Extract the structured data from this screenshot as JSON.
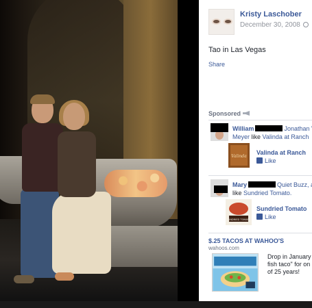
{
  "photo": {
    "alt": "Tao in Las Vegas photo"
  },
  "post": {
    "author": "Kristy Laschober",
    "date": "December 30, 2008",
    "caption": "Tao in Las Vegas",
    "share_label": "Share"
  },
  "sponsored": {
    "title": "Sponsored",
    "social_ads": [
      {
        "name": "William",
        "text_line1": "Jonathan V",
        "text_line2_link": "Meyer",
        "text_line2_mid": " like ",
        "text_line2_page": "Valinda at Ranch",
        "page_name": "Valinda at Ranch",
        "thumb_label": "Valinda",
        "like_label": "Like"
      },
      {
        "name": "Mary",
        "text_line1": "Quiet Buzz, a",
        "text_line2_mid": "like ",
        "text_line2_page": "Sundried Tomato.",
        "page_name": "Sundried Tomato",
        "thumb_label": "SUNDRIED TOMATO",
        "like_label": "Like"
      }
    ],
    "ad": {
      "title": "$.25 TACOS AT WAHOO'S",
      "domain": "wahoos.com",
      "body_lines": [
        "Drop in January",
        "fish taco\" for on",
        "of 25 years!"
      ]
    }
  }
}
